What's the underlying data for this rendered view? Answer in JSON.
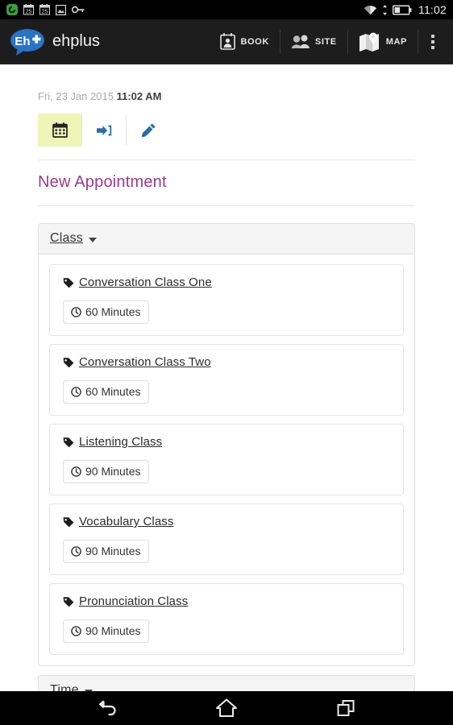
{
  "status_bar": {
    "icons": [
      "app-circle-icon",
      "calendar-25-icon",
      "calendar-25-icon",
      "gallery-icon",
      "key-icon"
    ],
    "wifi_icon": "wifi-icon",
    "data_icon": "data-transfer-icon",
    "battery_icon": "battery-icon",
    "time": "11:02"
  },
  "action_bar": {
    "logo_text": "Eh",
    "brand": "ehplus",
    "items": [
      {
        "icon": "book-calendar-icon",
        "label": "BOOK"
      },
      {
        "icon": "site-people-icon",
        "label": "SITE"
      },
      {
        "icon": "map-icon",
        "label": "MAP"
      }
    ],
    "overflow_icon": "overflow-menu-icon"
  },
  "page": {
    "date": "Fri, 23 Jan 2015",
    "time": "11:02 AM",
    "tabs": [
      {
        "name": "calendar-tab",
        "icon": "calendar-icon",
        "active": true
      },
      {
        "name": "login-tab",
        "icon": "login-arrow-icon",
        "active": false
      },
      {
        "name": "edit-tab",
        "icon": "pencil-icon",
        "active": false
      }
    ],
    "title": "New Appointment",
    "sections": [
      {
        "header": "Class",
        "items": [
          {
            "name": "Conversation Class One",
            "duration": "60 Minutes"
          },
          {
            "name": "Conversation Class Two",
            "duration": "60 Minutes"
          },
          {
            "name": "Listening Class",
            "duration": "90 Minutes"
          },
          {
            "name": "Vocabulary Class",
            "duration": "90 Minutes"
          },
          {
            "name": "Pronunciation Class",
            "duration": "90 Minutes"
          }
        ]
      },
      {
        "header": "Time",
        "items": []
      }
    ]
  },
  "nav_bar": {
    "back": "back-icon",
    "home": "home-icon",
    "recents": "recents-icon"
  },
  "colors": {
    "accent_title": "#9b3a8e",
    "active_tab": "#edf5b7",
    "action_bar": "#1d1d1d",
    "link": "#2b6fa8"
  }
}
